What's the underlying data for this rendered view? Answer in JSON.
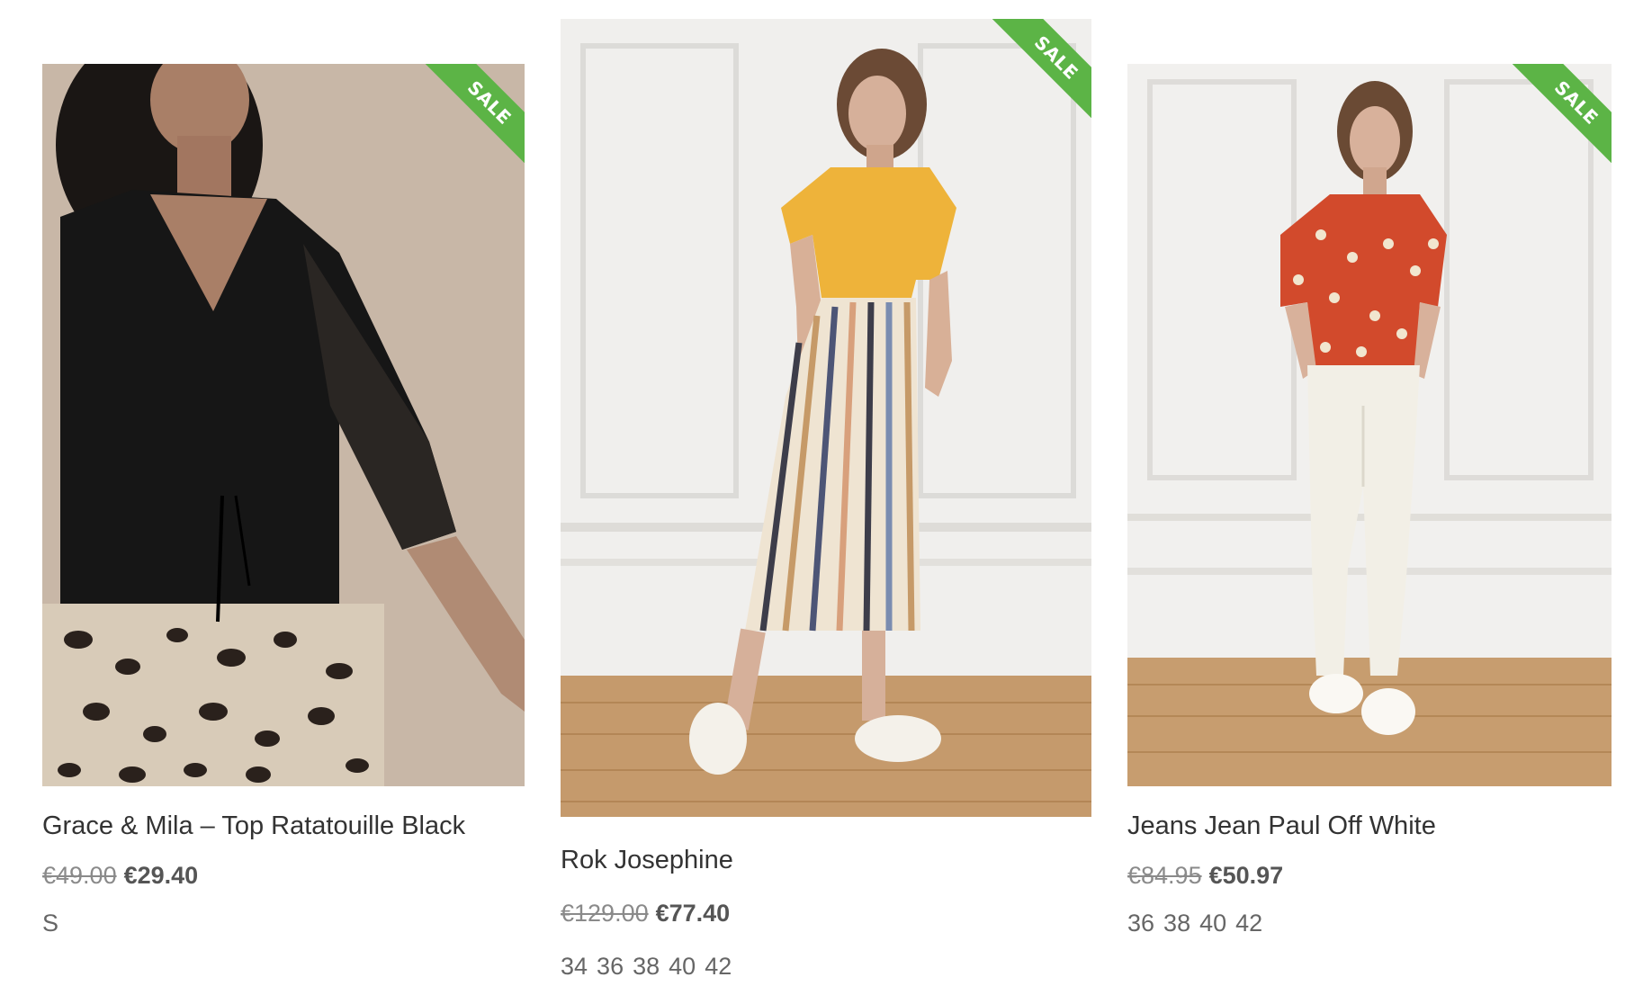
{
  "products": [
    {
      "badge": "SALE",
      "title": "Grace & Mila – Top Ratatouille Black",
      "old_price": "€49.00",
      "new_price": "€29.40",
      "sizes": [
        "S"
      ]
    },
    {
      "badge": "SALE",
      "title": "Rok Josephine",
      "old_price": "€129.00",
      "new_price": "€77.40",
      "sizes": [
        "34",
        "36",
        "38",
        "40",
        "42"
      ]
    },
    {
      "badge": "SALE",
      "title": "Jeans Jean Paul Off White",
      "old_price": "€84.95",
      "new_price": "€50.97",
      "sizes": [
        "36",
        "38",
        "40",
        "42"
      ]
    }
  ],
  "colors": {
    "sale_badge": "#5cb446",
    "title": "#333333",
    "old_price": "#8a8a8a",
    "new_price": "#555555"
  }
}
